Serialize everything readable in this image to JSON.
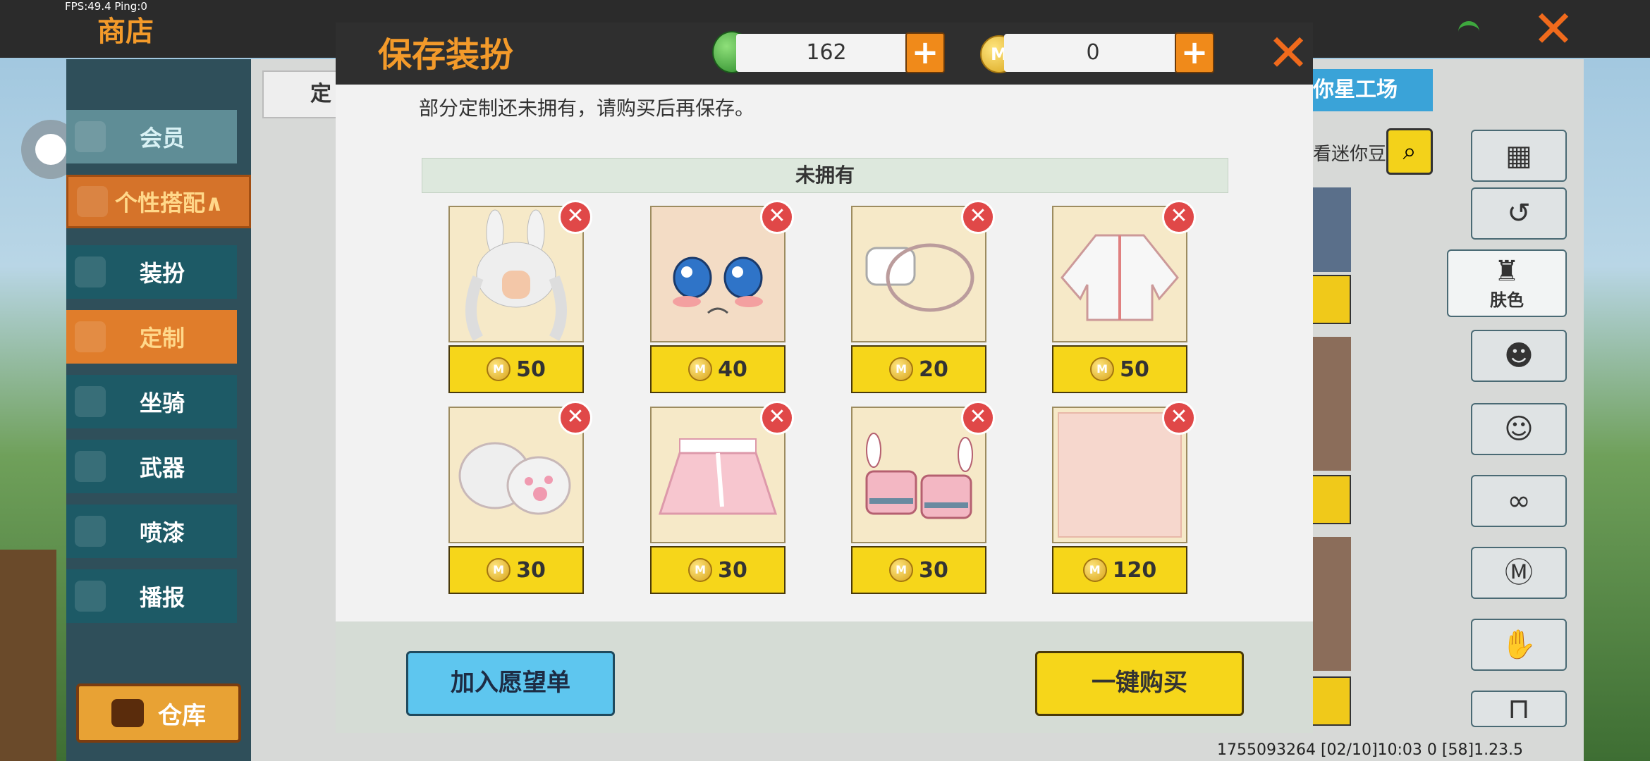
{
  "status": {
    "fps": "FPS:49.4  Ping:0"
  },
  "shop": {
    "title": "商店"
  },
  "sidebar": {
    "member": "会员",
    "group": "个性搭配∧",
    "items": [
      "装扮",
      "定制",
      "坐骑",
      "武器",
      "喷漆",
      "播报"
    ],
    "active_index": 1,
    "warehouse": "仓库"
  },
  "background": {
    "tab_label": "定",
    "star_tab": "你星工场",
    "search_label": "看迷你豆",
    "skin_tool": "肤色",
    "footer": "1755093264   [02/10]10:03 0   [58]1.23.5"
  },
  "modal": {
    "title": "保存装扮",
    "currency": {
      "gems": "162",
      "coins": "0"
    },
    "notice": "部分定制还未拥有，请购买后再保存。",
    "section_title": "未拥有",
    "items": [
      {
        "name": "bunny-hair",
        "price": "50"
      },
      {
        "name": "face",
        "price": "40"
      },
      {
        "name": "mask",
        "price": "20"
      },
      {
        "name": "jacket",
        "price": "50"
      },
      {
        "name": "paw-gloves",
        "price": "30"
      },
      {
        "name": "skirt",
        "price": "30"
      },
      {
        "name": "bunny-shoes",
        "price": "30"
      },
      {
        "name": "skin-tone",
        "price": "120"
      }
    ],
    "wishlist_button": "加入愿望单",
    "buy_button": "一键购买"
  },
  "colors": {
    "accent_orange": "#f39a2a",
    "buy_yellow": "#f6d61a",
    "wish_blue": "#5ec6ef",
    "remove_red": "#e04848"
  }
}
